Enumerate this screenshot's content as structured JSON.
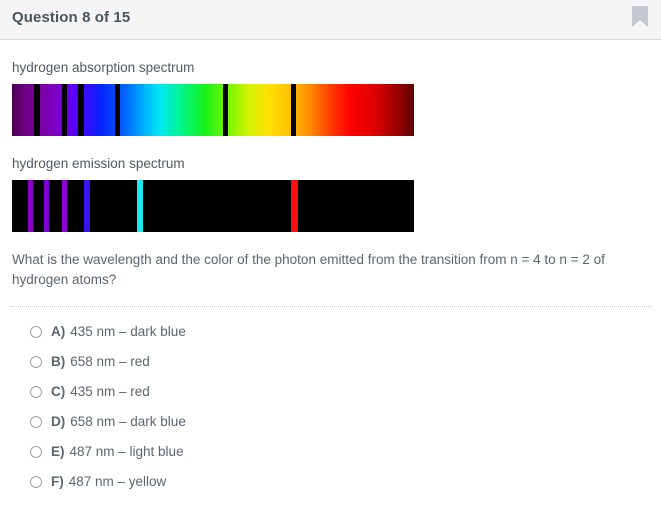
{
  "header": {
    "title": "Question 8 of 15",
    "bookmark_icon": "bookmark-icon",
    "bookmark_color": "#c4c9d0",
    "background": "#f5f5f5"
  },
  "spectra": [
    {
      "label": "hydrogen absorption spectrum",
      "type": "absorption",
      "lines": [
        {
          "x_pct": 5.5,
          "width": 1.5,
          "color": "#000000"
        },
        {
          "x_pct": 12.5,
          "width": 1.2,
          "color": "#000000"
        },
        {
          "x_pct": 16.5,
          "width": 1.5,
          "color": "#000000"
        },
        {
          "x_pct": 25.5,
          "width": 1.4,
          "color": "#000000"
        },
        {
          "x_pct": 52.5,
          "width": 1.2,
          "color": "#000000"
        },
        {
          "x_pct": 69.5,
          "width": 1.2,
          "color": "#000000"
        }
      ]
    },
    {
      "label": "hydrogen emission spectrum",
      "type": "emission",
      "lines": [
        {
          "x_pct": 4.0,
          "width": 1.2,
          "color": "#8a00c8"
        },
        {
          "x_pct": 8.0,
          "width": 1.2,
          "color": "#7d00d2"
        },
        {
          "x_pct": 12.5,
          "width": 1.2,
          "color": "#9000d8"
        },
        {
          "x_pct": 18.0,
          "width": 1.4,
          "color": "#3c14f0"
        },
        {
          "x_pct": 31.0,
          "width": 1.6,
          "color": "#19e8f0"
        },
        {
          "x_pct": 69.5,
          "width": 1.6,
          "color": "#ff1010"
        }
      ]
    }
  ],
  "question": {
    "text": "What is the wavelength and the color of the photon emitted from the transition from n = 4 to n = 2 of hydrogen atoms?"
  },
  "options": [
    {
      "letter": "A)",
      "text": "435 nm – dark blue"
    },
    {
      "letter": "B)",
      "text": "658 nm – red"
    },
    {
      "letter": "C)",
      "text": "435 nm – red"
    },
    {
      "letter": "D)",
      "text": "658 nm – dark blue"
    },
    {
      "letter": "E)",
      "text": "487 nm – light blue"
    },
    {
      "letter": "F)",
      "text": "487 nm – yellow"
    }
  ]
}
